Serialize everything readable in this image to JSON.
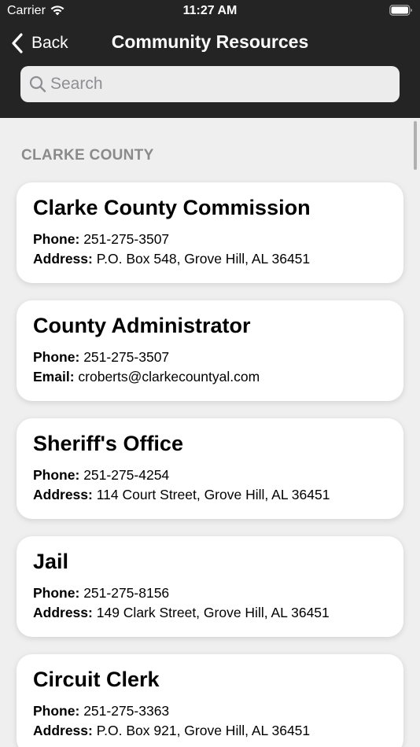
{
  "status_bar": {
    "carrier": "Carrier",
    "time": "11:27 AM"
  },
  "nav": {
    "back_label": "Back",
    "title": "Community Resources"
  },
  "search": {
    "placeholder": "Search",
    "value": ""
  },
  "section": {
    "header": "CLARKE COUNTY"
  },
  "cards": [
    {
      "title": "Clarke County Commission",
      "line1_label": "Phone:",
      "line1_value": "251-275-3507",
      "line2_label": "Address:",
      "line2_value": "P.O. Box 548, Grove Hill, AL 36451"
    },
    {
      "title": "County Administrator",
      "line1_label": "Phone:",
      "line1_value": "251-275-3507",
      "line2_label": "Email:",
      "line2_value": "croberts@clarkecountyal.com"
    },
    {
      "title": "Sheriff's Office",
      "line1_label": "Phone:",
      "line1_value": "251-275-4254",
      "line2_label": "Address:",
      "line2_value": "114 Court Street, Grove Hill, AL 36451"
    },
    {
      "title": "Jail",
      "line1_label": "Phone:",
      "line1_value": "251-275-8156",
      "line2_label": "Address:",
      "line2_value": "149 Clark Street, Grove Hill, AL 36451"
    },
    {
      "title": "Circuit Clerk",
      "line1_label": "Phone:",
      "line1_value": "251-275-3363",
      "line2_label": "Address:",
      "line2_value": "P.O. Box 921, Grove Hill, AL 36451"
    }
  ],
  "colors": {
    "header_bg": "#242424",
    "list_bg": "#efefef",
    "card_bg": "#ffffff",
    "section_header": "#8a8a8a",
    "placeholder": "#8e8e93"
  },
  "icons": {
    "wifi": "wifi-icon",
    "battery": "battery-icon",
    "back": "chevron-left-icon",
    "search": "search-icon"
  }
}
